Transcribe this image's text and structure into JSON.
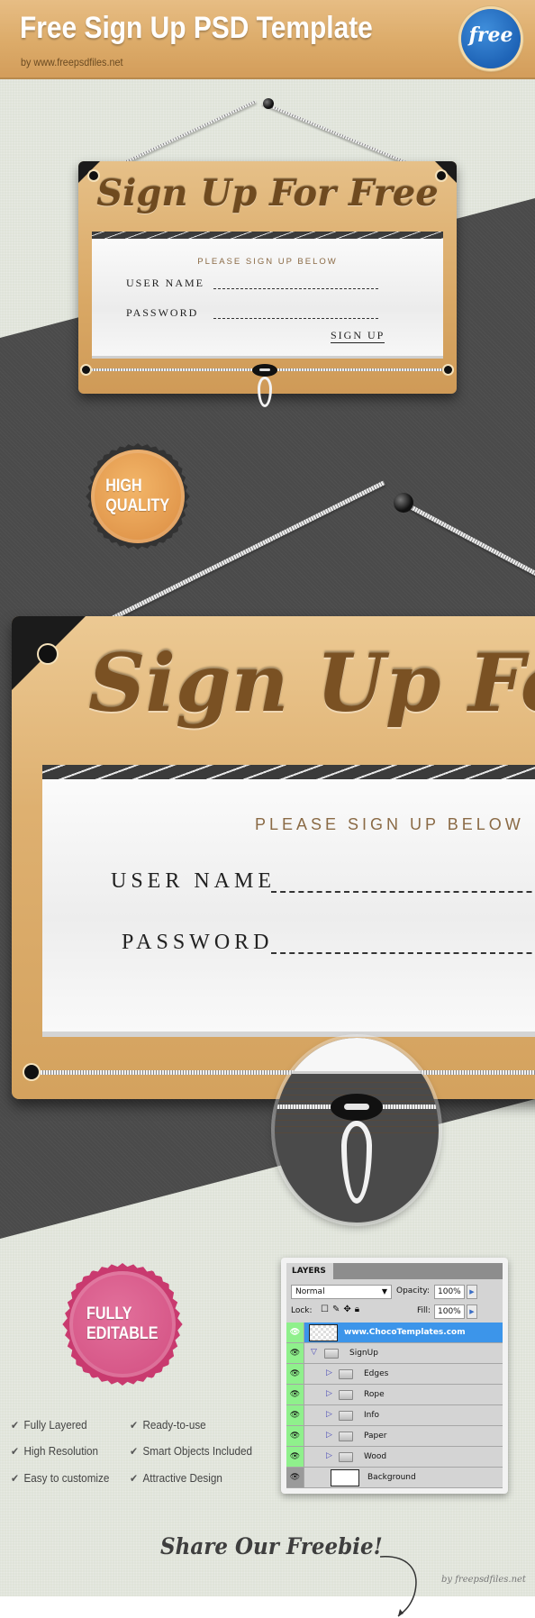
{
  "header": {
    "title": "Free Sign Up PSD Template",
    "subtitle": "by www.freepsdfiles.net",
    "badge_label": "free"
  },
  "colors": {
    "background_light": "#dfe3d9",
    "background_dark": "#4a4a4a",
    "wood": "#dcab69",
    "script_brown": "#7a5123",
    "free_badge_blue": "#1e63b6",
    "quality_badge_orange": "#e0954a",
    "editable_badge_pink": "#d65687",
    "layer_selected_blue": "#3c95ea",
    "layer_eye_green": "#8ff08c"
  },
  "small_sign": {
    "title": "Sign Up For Free",
    "prompt": "PLEASE SIGN UP BELOW",
    "username_label": "USER NAME",
    "password_label": "PASSWORD",
    "submit_label": "SIGN UP"
  },
  "quality_badge": {
    "line1": "HIGH",
    "line2": "QUALITY"
  },
  "big_sign": {
    "title": "Sign Up For Fr",
    "prompt": "PLEASE SIGN UP BELOW",
    "username_label": "USER NAME",
    "password_label": "PASSWORD"
  },
  "editable_badge": {
    "line1": "FULLY",
    "line2": "EDITABLE"
  },
  "features": [
    "Fully Layered",
    "High Resolution",
    "Easy to customize",
    "Ready-to-use",
    "Smart Objects Included",
    "Attractive Design"
  ],
  "layers_panel": {
    "tab": "LAYERS",
    "blend_mode": "Normal",
    "opacity_label": "Opacity:",
    "opacity_value": "100%",
    "lock_label": "Lock:",
    "fill_label": "Fill:",
    "fill_value": "100%",
    "layers": [
      {
        "name": "www.ChocoTemplates.com",
        "type": "layer",
        "selected": true
      },
      {
        "name": "SignUp",
        "type": "group",
        "expanded": true
      },
      {
        "name": "Edges",
        "type": "group",
        "indent": 1
      },
      {
        "name": "Rope",
        "type": "group",
        "indent": 1
      },
      {
        "name": "Info",
        "type": "group",
        "indent": 1
      },
      {
        "name": "Paper",
        "type": "group",
        "indent": 1
      },
      {
        "name": "Wood",
        "type": "group",
        "indent": 1
      },
      {
        "name": "Background",
        "type": "layer"
      }
    ]
  },
  "footer": {
    "share_text": "Share Our Freebie!",
    "credit": "by freepsdfiles.net"
  }
}
